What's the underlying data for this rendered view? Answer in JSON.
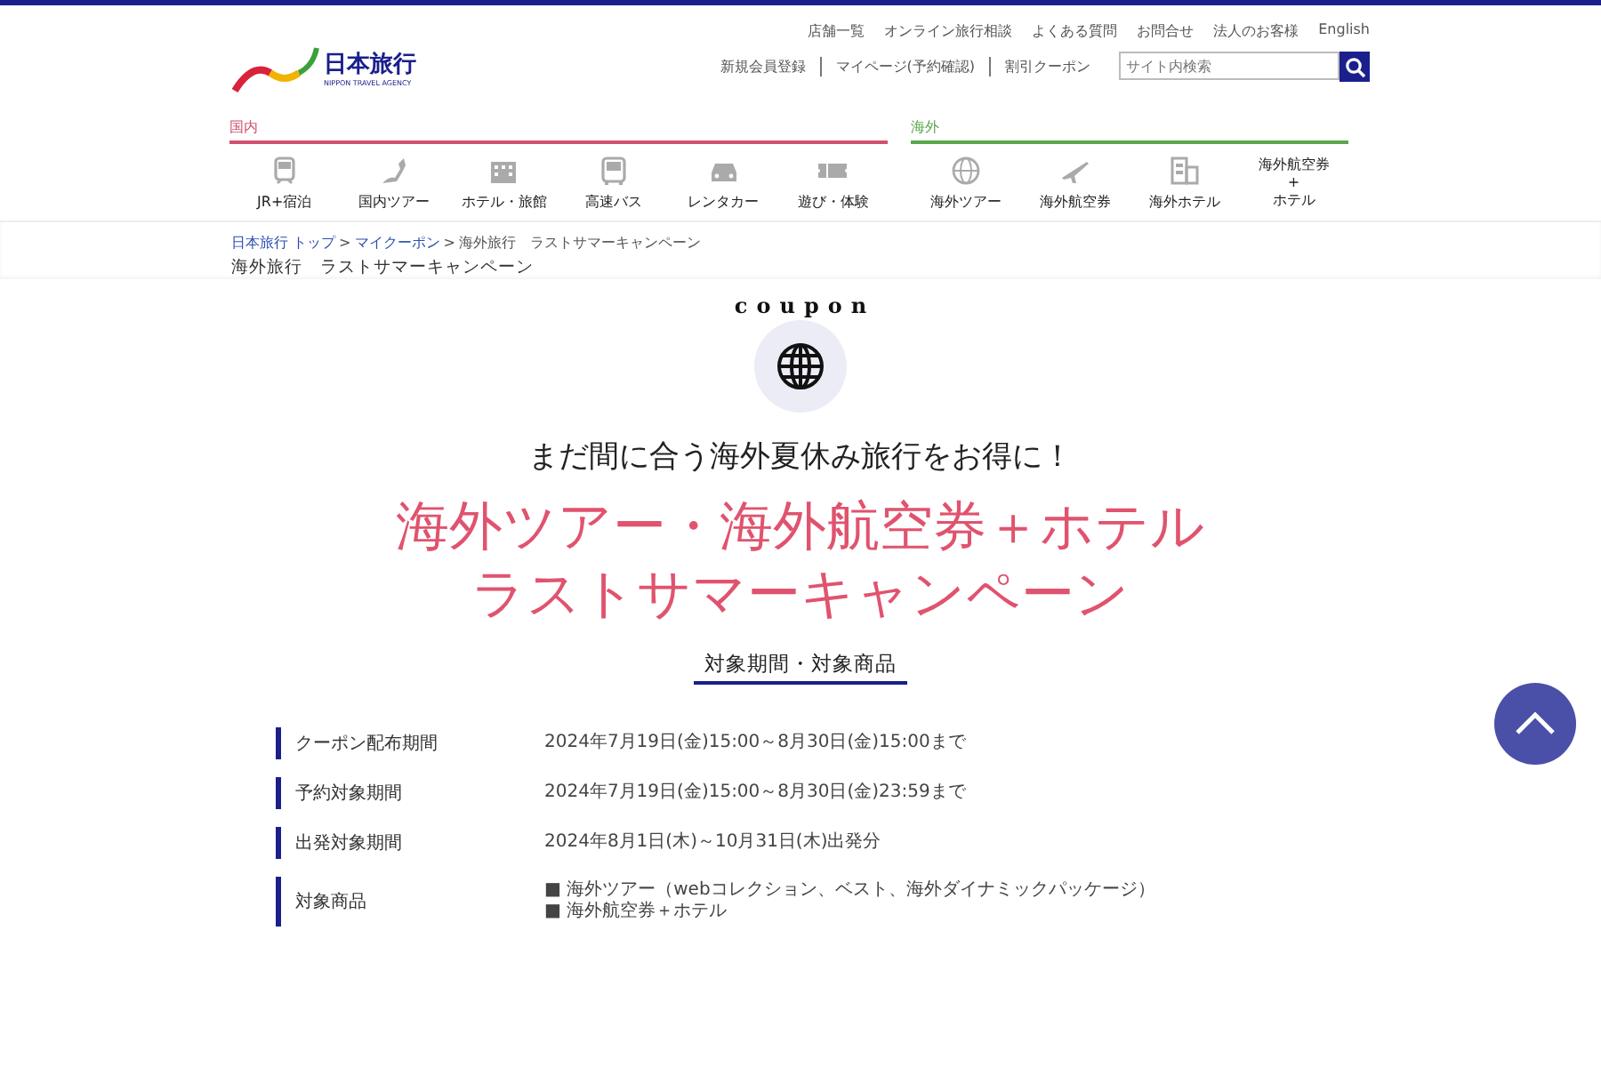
{
  "header": {
    "logo_text": "日本旅行",
    "logo_subtext": "NIPPON TRAVEL AGENCY",
    "top_links": [
      "店舗一覧",
      "オンライン旅行相談",
      "よくある質問",
      "お問合せ",
      "法人のお客様",
      "English"
    ],
    "sub_links": [
      "新規会員登録",
      "マイページ(予約確認)",
      "割引クーポン"
    ],
    "search": {
      "placeholder": "サイト内検索"
    }
  },
  "nav": [
    {
      "title": "国内",
      "kind": "domestic",
      "items": [
        {
          "label": "JR+宿泊"
        },
        {
          "label": "国内ツアー"
        },
        {
          "label": "ホテル・旅館"
        },
        {
          "label": "高速バス"
        },
        {
          "label": "レンタカー"
        },
        {
          "label": "遊び・体験"
        }
      ]
    },
    {
      "title": "海外",
      "kind": "overseas",
      "items": [
        {
          "label": "海外ツアー"
        },
        {
          "label": "海外航空券"
        },
        {
          "label": "海外ホテル"
        },
        {
          "label": "海外航空券\n+\nホテル"
        }
      ]
    }
  ],
  "breadcrumb": {
    "links": [
      "日本旅行 トップ",
      "マイクーポン"
    ],
    "separator": ">",
    "current": "海外旅行　ラストサマーキャンペーン"
  },
  "page_title": "海外旅行　ラストサマーキャンペーン",
  "badge": {
    "arc_text": "coupon"
  },
  "lead": "まだ間に合う海外夏休み旅行をお得に！",
  "headline": [
    "海外ツアー・海外航空券＋ホテル",
    "ラストサマーキャンペーン"
  ],
  "section_title": "対象期間・対象商品",
  "details": [
    {
      "label": "クーポン配布期間",
      "values": [
        "2024年7月19日(金)15:00～8月30日(金)15:00まで"
      ]
    },
    {
      "label": "予約対象期間",
      "values": [
        "2024年7月19日(金)15:00～8月30日(金)23:59まで"
      ]
    },
    {
      "label": "出発対象期間",
      "values": [
        "2024年8月1日(木)～10月31日(木)出発分"
      ]
    },
    {
      "label": "対象商品",
      "values": [
        "■ 海外ツアー（webコレクション、ベスト、海外ダイナミックパッケージ）",
        "■ 海外航空券＋ホテル"
      ]
    }
  ]
}
